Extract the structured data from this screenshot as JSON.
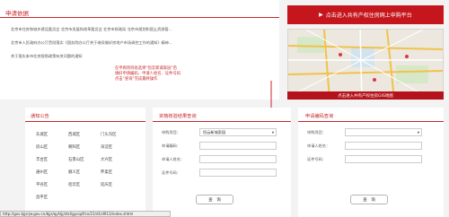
{
  "news": {
    "title": "申请依据",
    "lines": [
      "北京市住房和城乡建设委员会 北京市发展和改革委员会 北京市财政局 北京市规划和国土资源管...",
      "北京市人民政府办公厅贯彻落实《国务院办公厅关于继续做好房地产市场调控工作的通知》精神...",
      "关于落实本市住房限购政策有关问题的通知"
    ]
  },
  "enter_button": {
    "label": "点击进入共有产权住房网上申购平台"
  },
  "map": {
    "bar_label": "点击进入共有产权住房GIS地图"
  },
  "callout": {
    "lines": [
      "在申购项目处选择“恒云新城家园”后",
      "填好申请编码、申请人姓名、证件号码",
      "点击“查询”完成最终操作"
    ]
  },
  "notice": {
    "title": "通知公告",
    "districts": [
      "东城区",
      "西城区",
      "门头沟区",
      "房山区",
      "朝阳区",
      "海淀区",
      "丰台区",
      "石景山区",
      "大兴区",
      "通州区",
      "顺义区",
      "怀柔区",
      "平谷区",
      "密云区",
      "延庆区",
      "昌平区",
      "延庆区"
    ]
  },
  "result_query": {
    "title": "资格核验结果查询",
    "project_label": "申购项目：",
    "project_value": "恒云新城家园",
    "code_label": "申请编码：",
    "name_label": "申请人姓名：",
    "id_label": "证件号码：",
    "button": "查　询"
  },
  "code_query": {
    "title": "申请编码查询",
    "project_label": "申购项目：",
    "name_label": "申请人姓名：",
    "id_label": "证件号码：",
    "button": "查　询"
  },
  "status": {
    "url": "http://gxs.bjjsrjw.gov.cn/bjjs/qyfzjj/ztzl/gycqzf/cx/21/d1/d913/index.shtml"
  }
}
